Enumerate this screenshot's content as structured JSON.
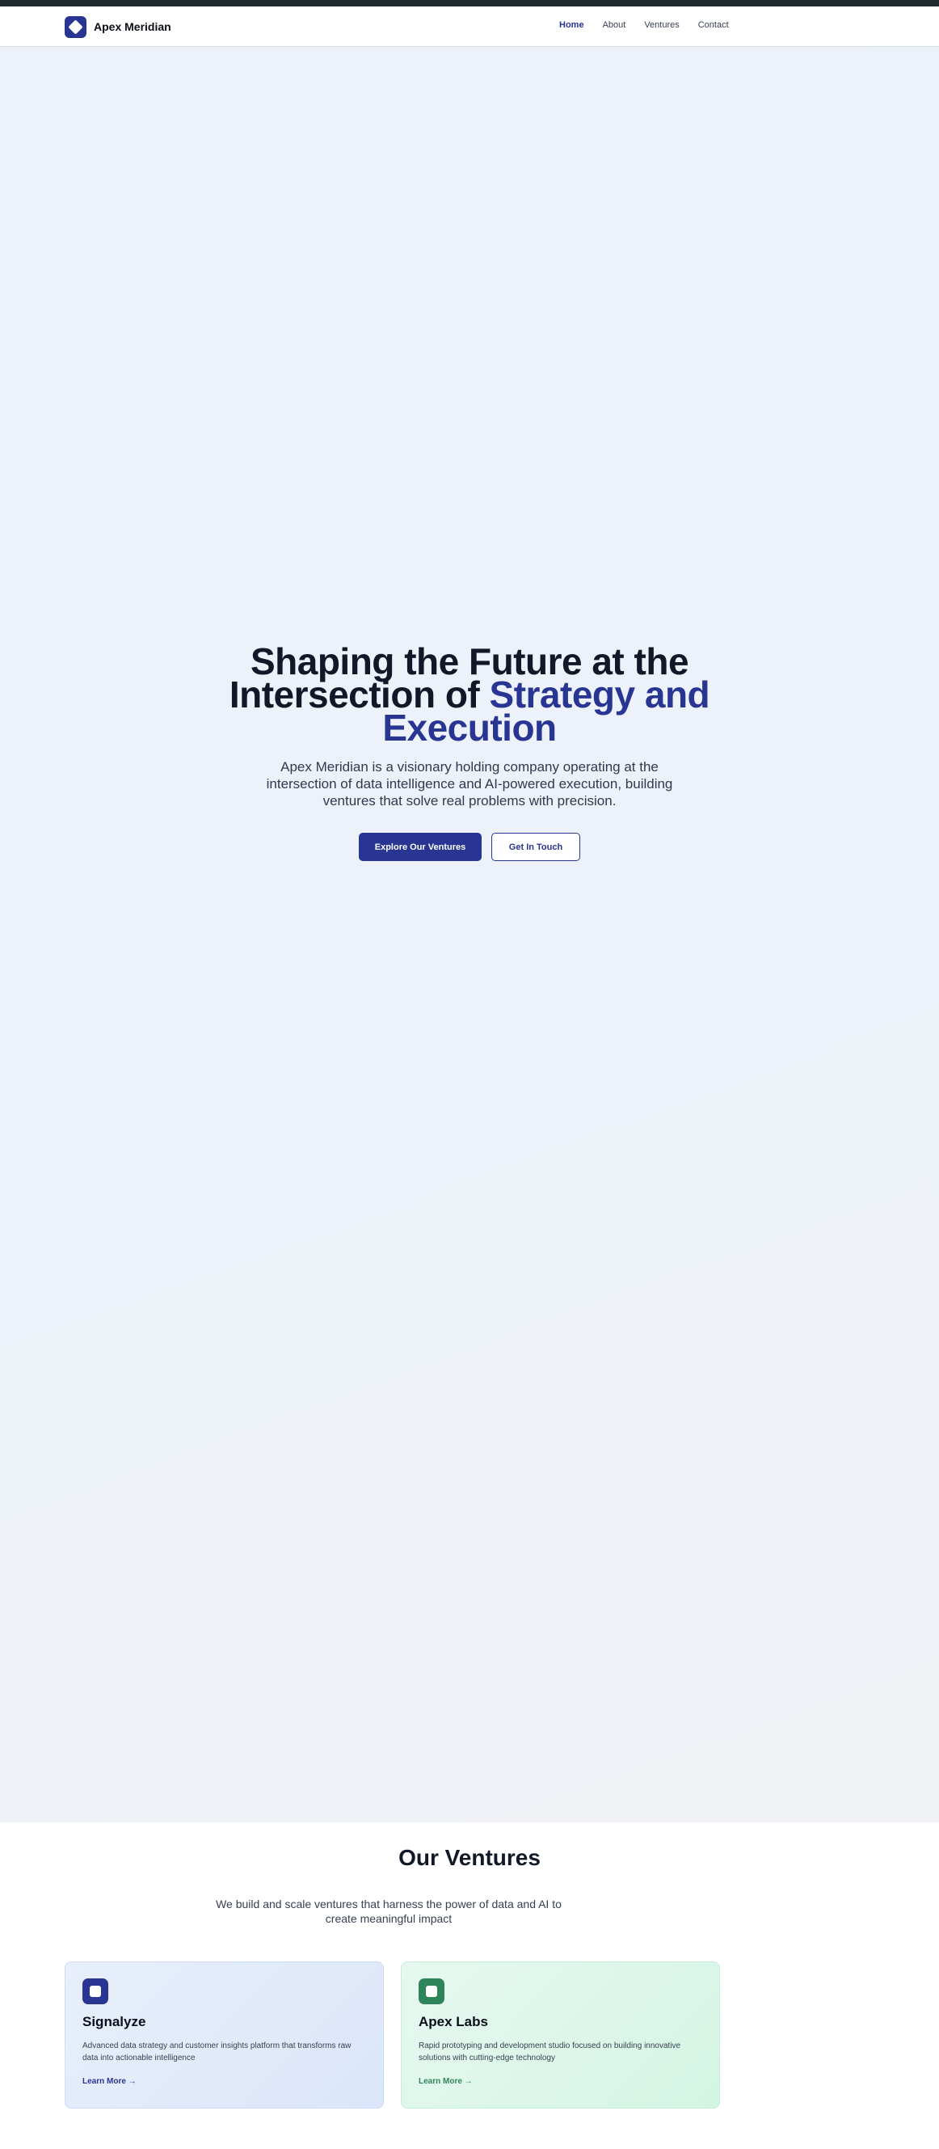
{
  "brand": {
    "name": "Apex Meridian",
    "logo_icon": "diamond-logo-icon",
    "color": "#283593"
  },
  "nav": {
    "links": [
      {
        "label": "Home",
        "active": true
      },
      {
        "label": "About",
        "active": false
      },
      {
        "label": "Ventures",
        "active": false
      },
      {
        "label": "Contact",
        "active": false
      }
    ]
  },
  "hero": {
    "title_part1": "Shaping the Future at the Intersection of ",
    "title_accent": "Strategy and Execution",
    "subtitle": "Apex Meridian is a visionary holding company operating at the intersection of data intelligence and AI-powered execution, building ventures that solve real problems with precision.",
    "primary_button": "Explore Our Ventures",
    "secondary_button": "Get In Touch"
  },
  "ventures": {
    "title": "Our Ventures",
    "subtitle": "We build and scale ventures that harness the power of data and AI to create meaningful impact",
    "cards": [
      {
        "name": "Signalyze",
        "description": "Advanced data strategy and customer insights platform that transforms raw data into actionable intelligence",
        "link": "Learn More →",
        "icon": "square-icon",
        "color": "#283593"
      },
      {
        "name": "Apex Labs",
        "description": "Rapid prototyping and development studio focused on building innovative solutions with cutting-edge technology",
        "link": "Learn More →",
        "icon": "square-icon",
        "color": "#2f855a"
      }
    ]
  },
  "colors": {
    "accent": "#283593",
    "green": "#2f855a",
    "topbar": "#1f2a2e"
  }
}
